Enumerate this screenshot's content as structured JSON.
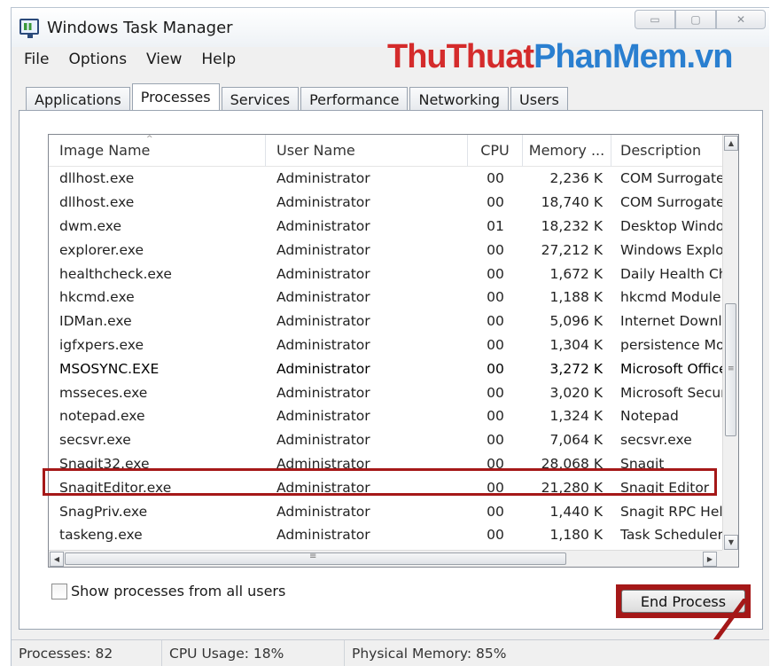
{
  "window": {
    "title": "Windows Task Manager",
    "minimize": "▭",
    "maximize": "▢",
    "close": "✕"
  },
  "watermark": {
    "part1": "ThuThuat",
    "part2": "PhanMem",
    "part3": ".vn"
  },
  "menu": [
    "File",
    "Options",
    "View",
    "Help"
  ],
  "tabs": [
    "Applications",
    "Processes",
    "Services",
    "Performance",
    "Networking",
    "Users"
  ],
  "active_tab": "Processes",
  "columns": [
    "Image Name",
    "User Name",
    "CPU",
    "Memory ...",
    "Description"
  ],
  "sort_indicator": "^",
  "processes": [
    {
      "name": "dllhost.exe",
      "user": "Administrator",
      "cpu": "00",
      "mem": "2,236 K",
      "desc": "COM Surrogate"
    },
    {
      "name": "dllhost.exe",
      "user": "Administrator",
      "cpu": "00",
      "mem": "18,740 K",
      "desc": "COM Surrogate"
    },
    {
      "name": "dwm.exe",
      "user": "Administrator",
      "cpu": "01",
      "mem": "18,232 K",
      "desc": "Desktop Window"
    },
    {
      "name": "explorer.exe",
      "user": "Administrator",
      "cpu": "00",
      "mem": "27,212 K",
      "desc": "Windows Explorer"
    },
    {
      "name": "healthcheck.exe",
      "user": "Administrator",
      "cpu": "00",
      "mem": "1,672 K",
      "desc": "Daily Health Check"
    },
    {
      "name": "hkcmd.exe",
      "user": "Administrator",
      "cpu": "00",
      "mem": "1,188 K",
      "desc": "hkcmd Module"
    },
    {
      "name": "IDMan.exe",
      "user": "Administrator",
      "cpu": "00",
      "mem": "5,096 K",
      "desc": "Internet Download"
    },
    {
      "name": "igfxpers.exe",
      "user": "Administrator",
      "cpu": "00",
      "mem": "1,304 K",
      "desc": "persistence Module"
    },
    {
      "name": "MSOSYNC.EXE",
      "user": "Administrator",
      "cpu": "00",
      "mem": "3,272 K",
      "desc": "Microsoft Office"
    },
    {
      "name": "msseces.exe",
      "user": "Administrator",
      "cpu": "00",
      "mem": "3,020 K",
      "desc": "Microsoft Security"
    },
    {
      "name": "notepad.exe",
      "user": "Administrator",
      "cpu": "00",
      "mem": "1,324 K",
      "desc": "Notepad"
    },
    {
      "name": "secsvr.exe",
      "user": "Administrator",
      "cpu": "00",
      "mem": "7,064 K",
      "desc": "secsvr.exe"
    },
    {
      "name": "Snagit32.exe",
      "user": "Administrator",
      "cpu": "00",
      "mem": "28,068 K",
      "desc": "Snagit"
    },
    {
      "name": "SnagitEditor.exe",
      "user": "Administrator",
      "cpu": "00",
      "mem": "21,280 K",
      "desc": "Snagit Editor"
    },
    {
      "name": "SnagPriv.exe",
      "user": "Administrator",
      "cpu": "00",
      "mem": "1,440 K",
      "desc": "Snagit RPC Helper"
    },
    {
      "name": "taskeng.exe",
      "user": "Administrator",
      "cpu": "00",
      "mem": "1,180 K",
      "desc": "Task Scheduler"
    }
  ],
  "highlight_color": "#a51818",
  "show_all_label": "Show processes from all users",
  "end_process_label": "End Process",
  "status": {
    "processes": "Processes: 82",
    "cpu": "CPU Usage: 18%",
    "memory": "Physical Memory: 85%"
  },
  "scroll": {
    "up": "▲",
    "down": "▼",
    "left": "◀",
    "right": "▶",
    "grip_v": "≡",
    "grip_h": "≡"
  }
}
